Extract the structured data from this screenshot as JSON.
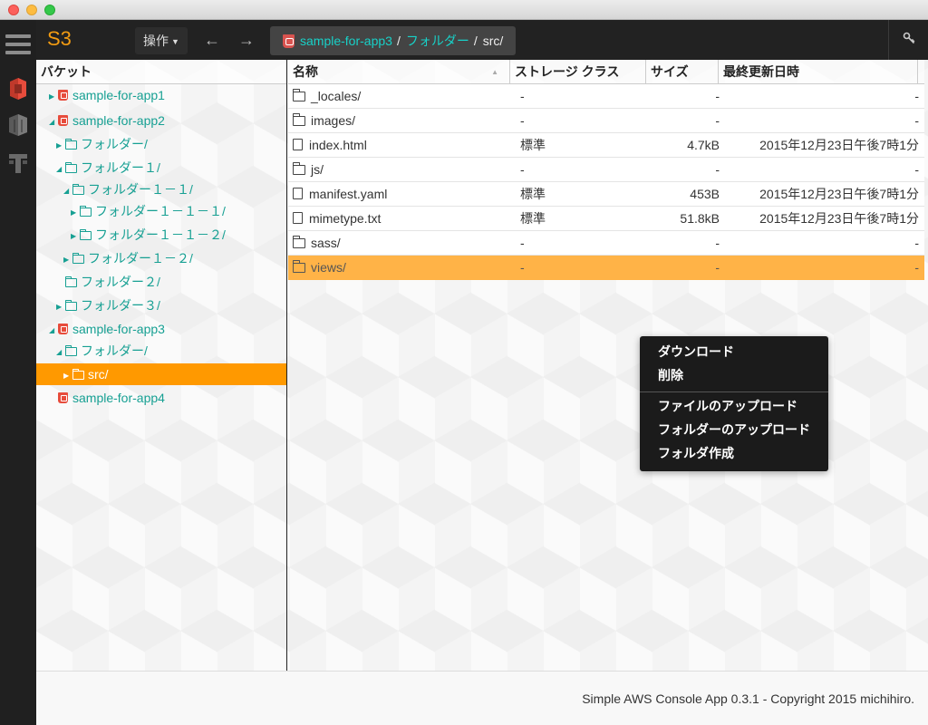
{
  "window": {
    "controls": [
      "close",
      "minimize",
      "maximize"
    ]
  },
  "sidebar": {
    "icons": [
      "menu-icon",
      "s3-icon",
      "ec2-icon",
      "dynamodb-icon"
    ]
  },
  "toolbar": {
    "brand": "S3",
    "operations_label": "操作",
    "back_icon": "←",
    "forward_icon": "→",
    "breadcrumb": {
      "bucket": "sample-for-app3",
      "folder": "フォルダー",
      "current": "src/",
      "separator": "/"
    },
    "key_icon": "🔑"
  },
  "tree": {
    "header": "バケット",
    "nodes": [
      {
        "label": "sample-for-app1",
        "type": "bucket",
        "expanded": false
      },
      {
        "label": "sample-for-app2",
        "type": "bucket",
        "expanded": true
      },
      {
        "label": "フォルダー/",
        "type": "folder",
        "expanded": false
      },
      {
        "label": "フォルダー１/",
        "type": "folder",
        "expanded": true
      },
      {
        "label": "フォルダー１－１/",
        "type": "folder",
        "expanded": true
      },
      {
        "label": "フォルダー１－１－１/",
        "type": "folder",
        "expanded": false
      },
      {
        "label": "フォルダー１－１－２/",
        "type": "folder",
        "expanded": false
      },
      {
        "label": "フォルダー１－２/",
        "type": "folder",
        "expanded": false
      },
      {
        "label": "フォルダー２/",
        "type": "folder",
        "expanded": false
      },
      {
        "label": "フォルダー３/",
        "type": "folder",
        "expanded": false
      },
      {
        "label": "sample-for-app3",
        "type": "bucket",
        "expanded": true
      },
      {
        "label": "フォルダー/",
        "type": "folder",
        "expanded": true
      },
      {
        "label": "src/",
        "type": "folder",
        "expanded": false,
        "selected": true
      },
      {
        "label": "sample-for-app4",
        "type": "bucket",
        "expanded": false
      }
    ]
  },
  "files": {
    "columns": [
      "名称",
      "ストレージ クラス",
      "サイズ",
      "最終更新日時"
    ],
    "rows": [
      {
        "name": "_locales/",
        "kind": "dir",
        "class": "-",
        "size": "-",
        "date": "-"
      },
      {
        "name": "images/",
        "kind": "dir",
        "class": "-",
        "size": "-",
        "date": "-"
      },
      {
        "name": "index.html",
        "kind": "file",
        "class": "標準",
        "size": "4.7kB",
        "date": "2015年12月23日午後7時1分"
      },
      {
        "name": "js/",
        "kind": "dir",
        "class": "-",
        "size": "-",
        "date": "-"
      },
      {
        "name": "manifest.yaml",
        "kind": "file",
        "class": "標準",
        "size": "453B",
        "date": "2015年12月23日午後7時1分"
      },
      {
        "name": "mimetype.txt",
        "kind": "file",
        "class": "標準",
        "size": "51.8kB",
        "date": "2015年12月23日午後7時1分"
      },
      {
        "name": "sass/",
        "kind": "dir",
        "class": "-",
        "size": "-",
        "date": "-"
      },
      {
        "name": "views/",
        "kind": "dir",
        "class": "-",
        "size": "-",
        "date": "-",
        "highlighted": true
      }
    ]
  },
  "context_menu": {
    "items": [
      "ダウンロード",
      "削除",
      "ファイルのアップロード",
      "フォルダーのアップロード",
      "フォルダ作成"
    ]
  },
  "footer": {
    "text": "Simple AWS Console App 0.3.1 - Copyright 2015 michihiro."
  },
  "colors": {
    "accent": "#ff9900",
    "brand": "#f39c12",
    "link": "#17a093",
    "bucket": "#e74c3c"
  }
}
